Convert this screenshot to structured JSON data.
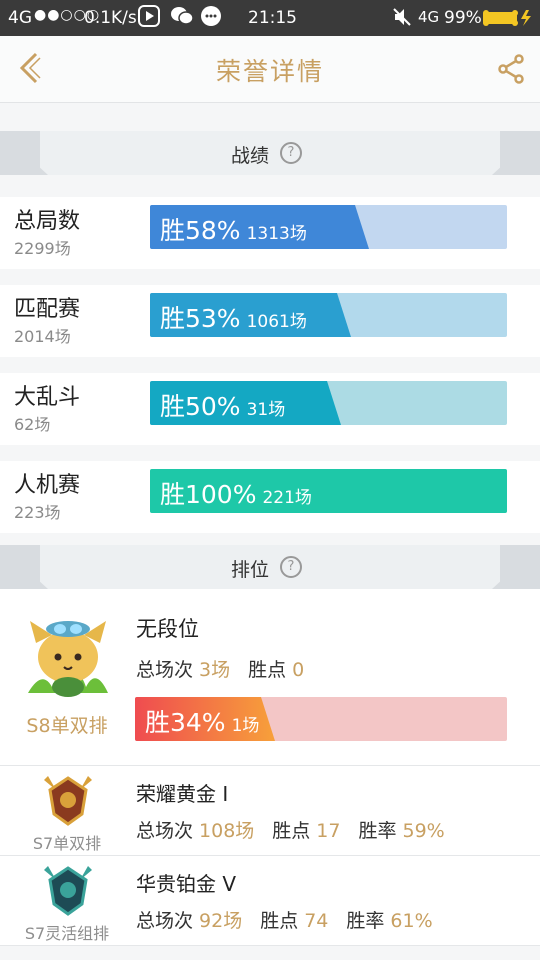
{
  "status_bar": {
    "signal": "4G",
    "net_speed": "0.1K/s",
    "time": "21:15",
    "network": "4G",
    "battery": "99%"
  },
  "header": {
    "title": "荣誉详情"
  },
  "record_section": {
    "title": "战绩",
    "rows": [
      {
        "name": "总局数",
        "total": "2299场",
        "rate_text": "胜58%",
        "wins_text": "1313场",
        "win_rate": 0.58,
        "fill": "#3f87d8",
        "track": "#c2d7f0"
      },
      {
        "name": "匹配赛",
        "total": "2014场",
        "rate_text": "胜53%",
        "wins_text": "1061场",
        "win_rate": 0.53,
        "fill": "#2a9fd0",
        "track": "#b2d9ec"
      },
      {
        "name": "大乱斗",
        "total": "62场",
        "rate_text": "胜50%",
        "wins_text": "31场",
        "win_rate": 0.5,
        "fill": "#14a8c3",
        "track": "#acdbe4"
      },
      {
        "name": "人机赛",
        "total": "223场",
        "rate_text": "胜100%",
        "wins_text": "221场",
        "win_rate": 1.0,
        "fill": "#1ec8a8",
        "track": "#b6ece0"
      }
    ]
  },
  "rank_section": {
    "title": "排位",
    "current": {
      "tier": "无段位",
      "season": "S8单双排",
      "games_label": "总场次",
      "games": "3场",
      "points_label": "胜点",
      "points": "0",
      "rate_text": "胜34%",
      "wins_text": "1场",
      "win_rate": 0.34
    },
    "history": [
      {
        "tier": "荣耀黄金 I",
        "season": "S7单双排",
        "games_label": "总场次",
        "games": "108场",
        "points_label": "胜点",
        "points": "17",
        "rate_label": "胜率",
        "rate": "59%"
      },
      {
        "tier": "华贵铂金 V",
        "season": "S7灵活组排",
        "games_label": "总场次",
        "games": "92场",
        "points_label": "胜点",
        "points": "74",
        "rate_label": "胜率",
        "rate": "61%"
      }
    ]
  }
}
